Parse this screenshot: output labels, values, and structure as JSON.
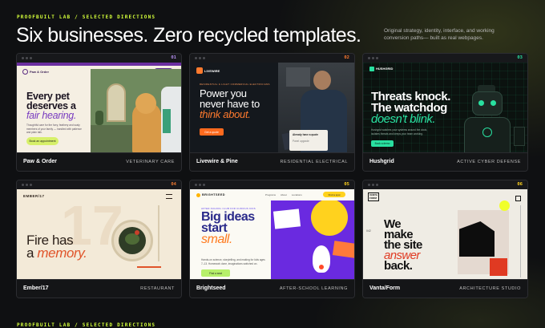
{
  "header": {
    "eyebrow": "PROOFBUILT LAB / SELECTED DIRECTIONS",
    "title": "Six businesses. Zero recycled templates.",
    "intro": "Original strategy, identity, interface, and working conversion paths— built as real webpages."
  },
  "footer": {
    "eyebrow": "PROOFBUILT LAB / SELECTED DIRECTIONS"
  },
  "colors": {
    "accent": "#d4ff3a",
    "background": "#0f1012"
  },
  "cards": [
    {
      "num": "01",
      "name": "Paw & Order",
      "category": "VETERINARY CARE",
      "color": "#b48ef0",
      "preview": {
        "logo": "Paw & Order",
        "nav_btn": "Book a visit",
        "headline_1": "Every pet",
        "headline_2": "deserves a",
        "headline_accent": "fair hearing.",
        "body": "Thoughtful care for the furry, feathery and scaly members of your family — handled with patience and plain talk.",
        "cta": "Book an appointment"
      }
    },
    {
      "num": "02",
      "name": "Livewire & Pine",
      "category": "RESIDENTIAL ELECTRICAL",
      "color": "#ff7a2e",
      "preview": {
        "logo": "LIVEWIRE",
        "eyebrow": "RESIDENTIAL & LIGHT COMMERCIAL ELECTRICIANS",
        "headline_1": "Power you",
        "headline_2": "never have to",
        "headline_accent": "think about.",
        "cta": "Get a quote",
        "card_1": "Already have a quote",
        "card_2": "Panel upgrade"
      }
    },
    {
      "num": "03",
      "name": "Hushgrid",
      "category": "ACTIVE CYBER DEFENSE",
      "color": "#29e0a0",
      "preview": {
        "logo": "HUSHGRID",
        "headline_1": "Threats knock.",
        "headline_2": "The watchdog",
        "headline_accent": "doesn't blink.",
        "body": "Hushgrid watches your systems around the clock, isolates threats and keeps your team working.",
        "cta": "Book a demo"
      }
    },
    {
      "num": "04",
      "name": "Ember/17",
      "category": "RESTAURANT",
      "color": "#f07830",
      "preview": {
        "logo": "EMBER/17",
        "headline_1": "Fire has",
        "headline_2": "a",
        "headline_accent": "memory."
      }
    },
    {
      "num": "05",
      "name": "Brightseed",
      "category": "AFTER-SCHOOL LEARNING",
      "color": "#ffd21e",
      "preview": {
        "logo": "BRIGHTSEED",
        "nav": [
          "Programs",
          "About",
          "Locations"
        ],
        "nav_btn": "Find a spot",
        "eyebrow": "AFTER-SCHOOL CLUB FOR CURIOUS KIDS",
        "headline_1": "Big ideas",
        "headline_2": "start",
        "headline_accent": "small.",
        "body": "Hands-on science, storytelling, and making for kids ages 7–13. Homework done, imaginations switched on.",
        "cta": "Find a seat"
      }
    },
    {
      "num": "06",
      "name": "Vanta/Form",
      "category": "ARCHITECTURE STUDIO",
      "color": "#ffd21e",
      "preview": {
        "logo": "VANTA FORM",
        "side_num": "042",
        "headline_1": "We",
        "headline_2": "make",
        "headline_3": "the site",
        "headline_accent": "answer",
        "headline_4": "back."
      }
    }
  ]
}
